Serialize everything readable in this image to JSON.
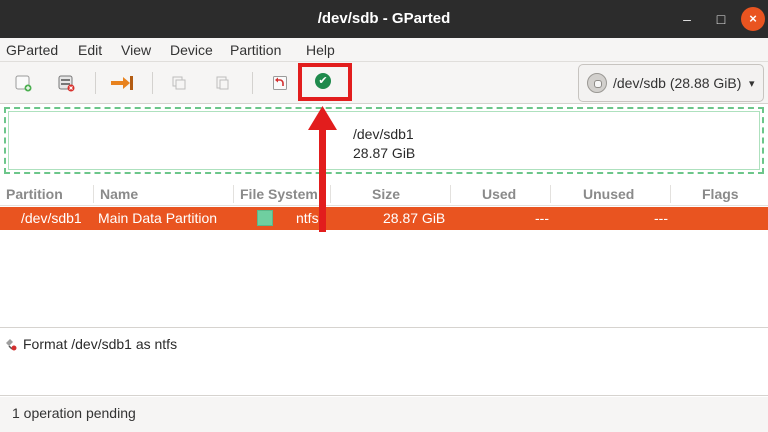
{
  "window": {
    "title": "/dev/sdb - GParted",
    "minimize_glyph": "–",
    "maximize_glyph": "□",
    "close_glyph": "×"
  },
  "menu": [
    "GParted",
    "Edit",
    "View",
    "Device",
    "Partition",
    "Help"
  ],
  "toolbar": {
    "icons": [
      "new-partition-icon",
      "delete-partition-icon",
      "resize-move-icon",
      "copy-icon",
      "paste-icon",
      "undo-icon",
      "apply-icon"
    ],
    "apply_glyph": "✔",
    "device_selector": "/dev/sdb  (28.88 GiB)",
    "device_chevron": "▾"
  },
  "graph": {
    "partition": "/dev/sdb1",
    "size": "28.87 GiB"
  },
  "table": {
    "columns": [
      "Partition",
      "Name",
      "File System",
      "Size",
      "Used",
      "Unused",
      "Flags"
    ],
    "rows": [
      {
        "partition": "/dev/sdb1",
        "name": "Main Data Partition",
        "filesystem": "ntfs",
        "size": "28.87 GiB",
        "used": "---",
        "unused": "---",
        "flags": ""
      }
    ]
  },
  "operations": [
    "Format /dev/sdb1 as ntfs"
  ],
  "status": "1 operation pending",
  "colors": {
    "selection": "#e95420",
    "ntfs_swatch": "#6fcfa0",
    "annotation": "#e21d1d",
    "apply": "#1f8a4c"
  }
}
